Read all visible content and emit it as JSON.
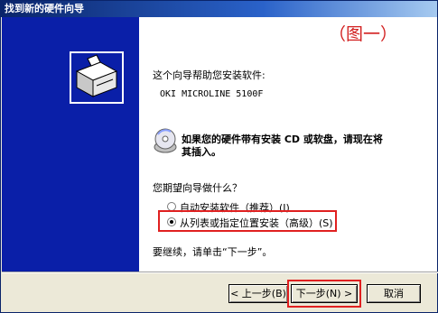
{
  "window": {
    "title": "找到新的硬件向导"
  },
  "annotation": "（图一）",
  "intro": "这个向导帮助您安装软件:",
  "device_name": "OKI MICROLINE 5100F",
  "cd_prompt_line1": "如果您的硬件带有安装 CD 或软盘，请现在将",
  "cd_prompt_line2": "其插入。",
  "question": "您期望向导做什么？",
  "options": [
    {
      "label": "自动安装软件（推荐）(I)",
      "selected": false
    },
    {
      "label": "从列表或指定位置安装（高级）(S)",
      "selected": true
    }
  ],
  "continue_text": "要继续，请单击“下一步”。",
  "buttons": {
    "back": "< 上一步(B)",
    "next": "下一步(N) >",
    "cancel": "取消"
  },
  "colors": {
    "side_panel": "#0a1fa8",
    "highlight": "#e02020"
  },
  "icons": {
    "wizard": "hardware-box-icon",
    "cd": "cd-disc-icon"
  }
}
